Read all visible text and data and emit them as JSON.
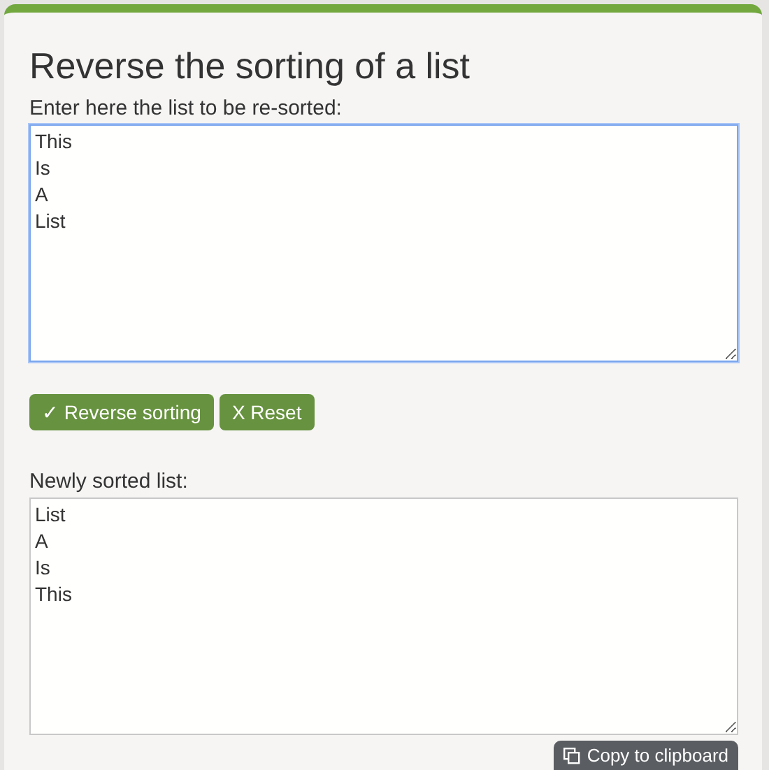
{
  "title": "Reverse the sorting of a list",
  "input": {
    "label": "Enter here the list to be re-sorted:",
    "value": "This\nIs\nA\nList",
    "focused": true
  },
  "buttons": [
    {
      "label": "✓ Reverse sorting"
    },
    {
      "label": "X Reset"
    }
  ],
  "output": {
    "label": "Newly sorted list:",
    "value": "List\nA\nIs\nThis",
    "focused": false
  },
  "copy_button": {
    "label": "Copy to clipboard"
  }
}
